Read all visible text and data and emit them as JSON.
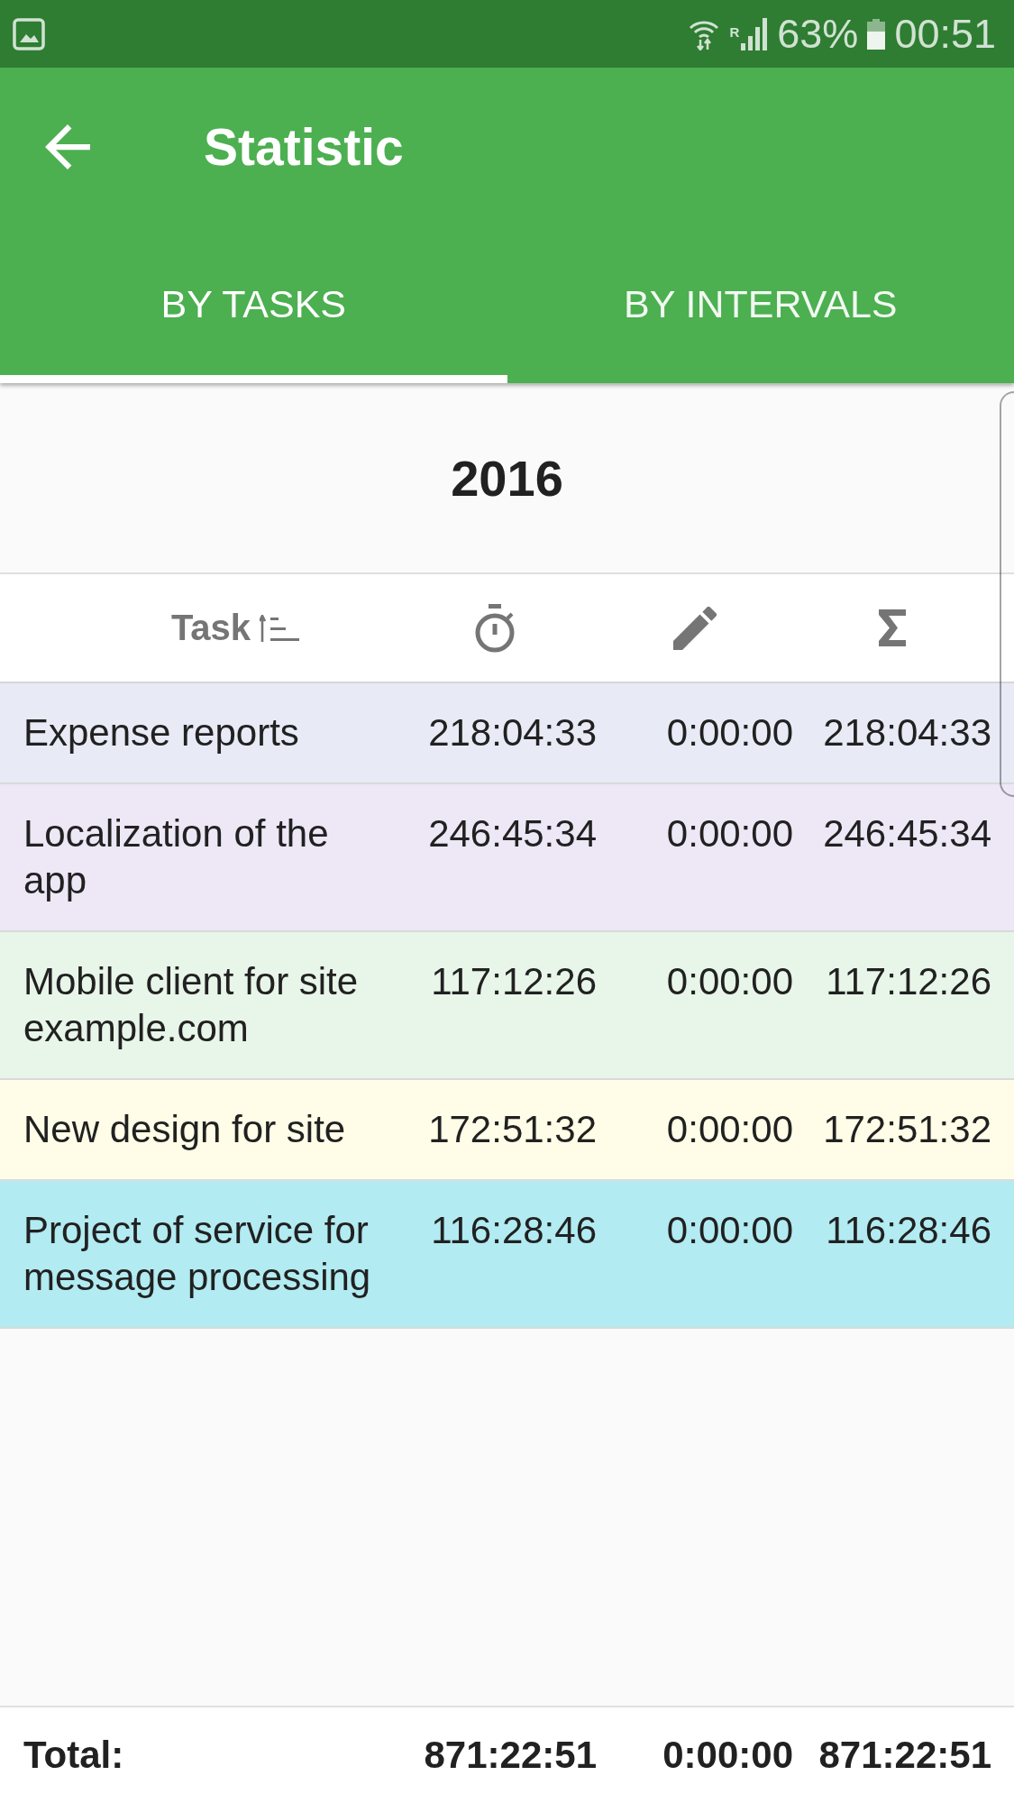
{
  "status_bar": {
    "roaming": "R",
    "battery": "63%",
    "time": "00:51"
  },
  "app_bar": {
    "title": "Statistic"
  },
  "tabs": [
    {
      "label": "BY TASKS",
      "selected": true
    },
    {
      "label": "BY INTERVALS",
      "selected": false
    }
  ],
  "period": {
    "title": "2016"
  },
  "table": {
    "task_header": {
      "label": "Task",
      "sorted": true
    },
    "rows": [
      {
        "task": "Expense reports",
        "values": [
          "218:04:33",
          "0:00:00",
          "218:04:33"
        ],
        "color": "#e8eaf6"
      },
      {
        "task": "Localization of the app",
        "values": [
          "246:45:34",
          "0:00:00",
          "246:45:34"
        ],
        "color": "#ede7f6"
      },
      {
        "task": "Mobile client for site example.com",
        "values": [
          "117:12:26",
          "0:00:00",
          "117:12:26"
        ],
        "color": "#e8f5e9"
      },
      {
        "task": "New design for site",
        "values": [
          "172:51:32",
          "0:00:00",
          "172:51:32"
        ],
        "color": "#fffde7"
      },
      {
        "task": "Project of service for message processing",
        "values": [
          "116:28:46",
          "0:00:00",
          "116:28:46"
        ],
        "color": "#b2ebf2"
      }
    ],
    "total": {
      "label": "Total:",
      "values": [
        "871:22:51",
        "0:00:00",
        "871:22:51"
      ]
    }
  }
}
